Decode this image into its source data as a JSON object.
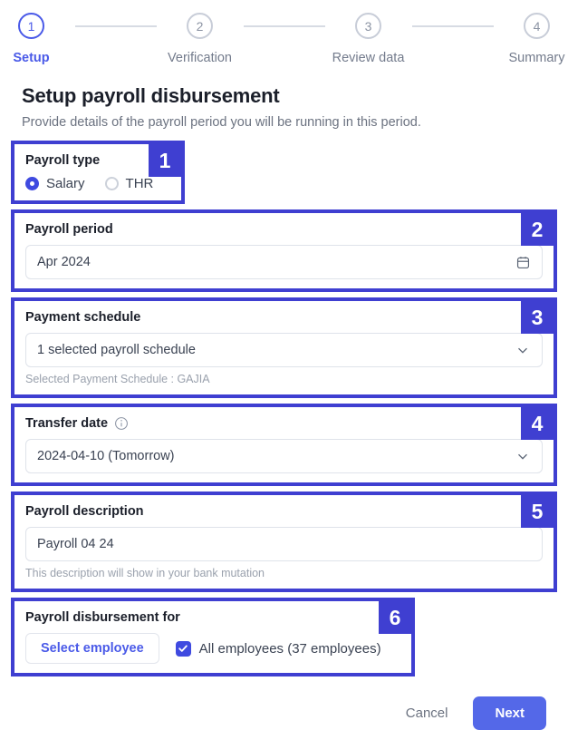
{
  "stepper": {
    "steps": [
      {
        "number": "1",
        "label": "Setup",
        "active": true
      },
      {
        "number": "2",
        "label": "Verification",
        "active": false
      },
      {
        "number": "3",
        "label": "Review data",
        "active": false
      },
      {
        "number": "4",
        "label": "Summary",
        "active": false
      }
    ]
  },
  "header": {
    "title": "Setup payroll disbursement",
    "subtitle": "Provide details of the payroll period you will be running in this period."
  },
  "sections": {
    "payroll_type": {
      "badge": "1",
      "label": "Payroll type",
      "options": [
        {
          "label": "Salary",
          "selected": true
        },
        {
          "label": "THR",
          "selected": false
        }
      ]
    },
    "payroll_period": {
      "badge": "2",
      "label": "Payroll period",
      "value": "Apr 2024",
      "icon": "calendar-icon"
    },
    "payment_schedule": {
      "badge": "3",
      "label": "Payment schedule",
      "value": "1 selected payroll schedule",
      "helper": "Selected Payment Schedule : GAJIA",
      "icon": "chevron-down-icon"
    },
    "transfer_date": {
      "badge": "4",
      "label": "Transfer date",
      "info_icon": "info-icon",
      "value": "2024-04-10 (Tomorrow)",
      "icon": "chevron-down-icon"
    },
    "payroll_description": {
      "badge": "5",
      "label": "Payroll description",
      "value": "Payroll 04 24",
      "helper": "This description will show in your bank mutation"
    },
    "disbursement_for": {
      "badge": "6",
      "label": "Payroll disbursement for",
      "select_employee_label": "Select employee",
      "all_employees_label": "All employees (37 employees)",
      "all_employees_checked": true
    }
  },
  "footer": {
    "cancel_label": "Cancel",
    "next_label": "Next"
  },
  "colors": {
    "highlight_border": "#3f3fd1",
    "accent": "#4a5ae8",
    "primary_button": "#5468e8",
    "inactive_step": "#c8cdd8"
  }
}
